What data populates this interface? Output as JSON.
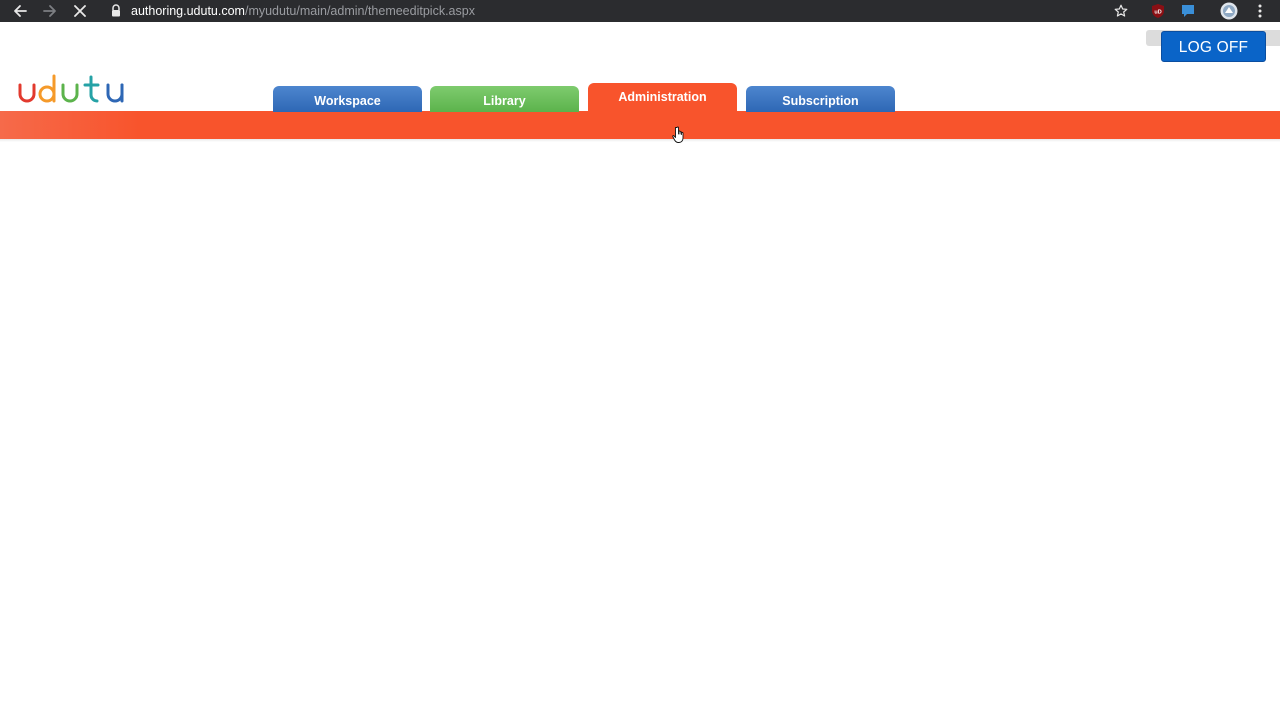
{
  "browser": {
    "url_host": "authoring.udutu.com",
    "url_path": "/myudutu/main/admin/themeeditpick.aspx",
    "icons": [
      "back-arrow-icon",
      "forward-arrow-icon",
      "stop-loading-icon",
      "lock-icon",
      "bookmark-star-icon",
      "extension-ublock-icon",
      "extension-chat-icon",
      "profile-avatar-icon",
      "menu-kebab-icon"
    ]
  },
  "header": {
    "logoff_label": "LOG OFF",
    "logo_text": "udutu"
  },
  "nav": {
    "tabs": [
      {
        "label": "Workspace"
      },
      {
        "label": "Library"
      },
      {
        "label": "Administration"
      },
      {
        "label": "Subscription"
      }
    ],
    "active_tab": "Administration"
  },
  "colors": {
    "nav_band": "#f8542c",
    "workspace_tab": "#2e67b5",
    "library_tab": "#5cb34c",
    "logoff_button": "#0a64c8",
    "browser_bar": "#2b2c2f"
  }
}
